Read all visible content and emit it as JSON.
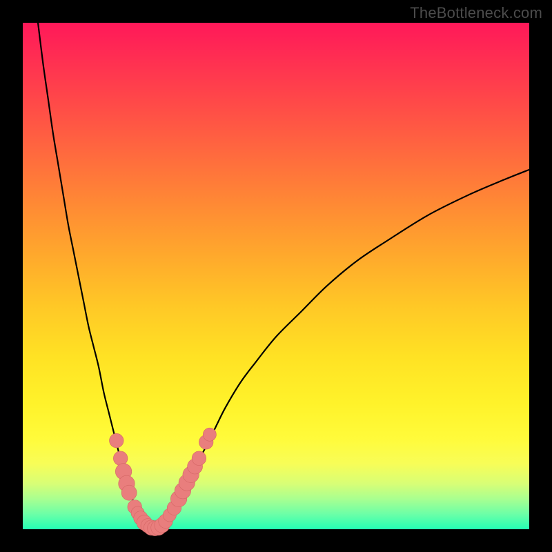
{
  "watermark": "TheBottleneck.com",
  "colors": {
    "curve_stroke": "#000000",
    "marker_fill": "#e97e7d",
    "marker_stroke": "#d46665"
  },
  "chart_data": {
    "type": "line",
    "title": "",
    "xlabel": "",
    "ylabel": "",
    "xlim": [
      0,
      100
    ],
    "ylim": [
      0,
      100
    ],
    "series": [
      {
        "name": "curve",
        "x": [
          3,
          4,
          5,
          6,
          7,
          8,
          9,
          10,
          11,
          12,
          13,
          14,
          15,
          16,
          17,
          18,
          19,
          20,
          21,
          22,
          23,
          24,
          25,
          26,
          27,
          28,
          30,
          32,
          34,
          36,
          38,
          40,
          43,
          46,
          50,
          55,
          60,
          66,
          72,
          80,
          88,
          95,
          100
        ],
        "y": [
          100,
          92,
          85,
          78,
          72,
          66,
          60,
          55,
          50,
          45,
          40,
          36,
          32,
          27,
          23,
          19,
          15,
          11,
          8,
          5,
          3,
          1.5,
          0.6,
          0.2,
          0.4,
          1.2,
          4,
          8,
          12,
          16,
          20,
          24,
          29,
          33,
          38,
          43,
          48,
          53,
          57,
          62,
          66,
          69,
          71
        ]
      }
    ],
    "markers": [
      {
        "x": 18.5,
        "y": 17.5,
        "r": 1.4
      },
      {
        "x": 19.3,
        "y": 14.0,
        "r": 1.4
      },
      {
        "x": 19.9,
        "y": 11.4,
        "r": 1.6
      },
      {
        "x": 20.5,
        "y": 9.0,
        "r": 1.6
      },
      {
        "x": 21.0,
        "y": 7.2,
        "r": 1.5
      },
      {
        "x": 22.1,
        "y": 4.4,
        "r": 1.4
      },
      {
        "x": 22.7,
        "y": 3.2,
        "r": 1.3
      },
      {
        "x": 23.3,
        "y": 2.2,
        "r": 1.4
      },
      {
        "x": 24.0,
        "y": 1.3,
        "r": 1.5
      },
      {
        "x": 24.7,
        "y": 0.7,
        "r": 1.4
      },
      {
        "x": 25.4,
        "y": 0.3,
        "r": 1.5
      },
      {
        "x": 26.1,
        "y": 0.2,
        "r": 1.5
      },
      {
        "x": 26.8,
        "y": 0.3,
        "r": 1.5
      },
      {
        "x": 27.5,
        "y": 0.8,
        "r": 1.5
      },
      {
        "x": 28.2,
        "y": 1.6,
        "r": 1.4
      },
      {
        "x": 29.0,
        "y": 2.8,
        "r": 1.3
      },
      {
        "x": 29.9,
        "y": 4.2,
        "r": 1.4
      },
      {
        "x": 30.8,
        "y": 6.0,
        "r": 1.6
      },
      {
        "x": 31.6,
        "y": 7.6,
        "r": 1.6
      },
      {
        "x": 32.4,
        "y": 9.2,
        "r": 1.6
      },
      {
        "x": 33.2,
        "y": 10.8,
        "r": 1.6
      },
      {
        "x": 34.0,
        "y": 12.4,
        "r": 1.5
      },
      {
        "x": 34.8,
        "y": 14.0,
        "r": 1.4
      },
      {
        "x": 36.2,
        "y": 17.2,
        "r": 1.4
      },
      {
        "x": 36.9,
        "y": 18.7,
        "r": 1.3
      }
    ]
  }
}
